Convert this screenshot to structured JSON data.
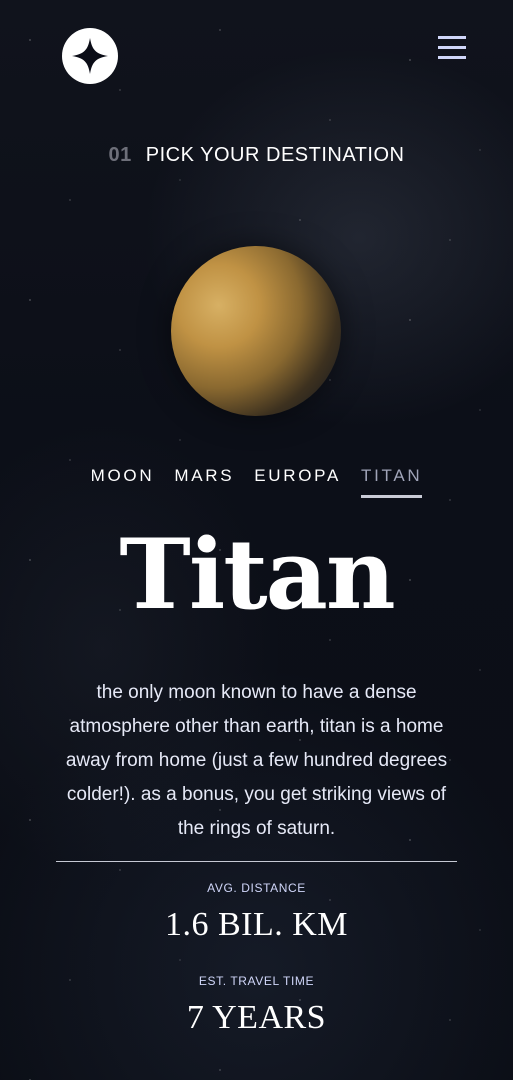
{
  "header": {
    "logo_icon": "star-logo-icon",
    "menu_icon": "hamburger-menu-icon"
  },
  "heading": {
    "number": "01",
    "title": "PICK YOUR DESTINATION"
  },
  "tabs": [
    {
      "label": "MOON",
      "active": false
    },
    {
      "label": "MARS",
      "active": false
    },
    {
      "label": "EUROPA",
      "active": false
    },
    {
      "label": "TITAN",
      "active": true
    }
  ],
  "destination": {
    "name": "Titan",
    "description": "the only moon known to have a dense atmosphere other than earth, titan is a home away from home (just a few hundred degrees colder!). as a bonus, you get striking views of the rings of saturn.",
    "distance_label": "AVG. DISTANCE",
    "distance_value": "1.6 BIL. KM",
    "travel_label": "EST. TRAVEL TIME",
    "travel_value": "7 YEARS"
  },
  "colors": {
    "background": "#0b0e17",
    "accent": "#d0d6f9",
    "text": "#ffffff"
  }
}
